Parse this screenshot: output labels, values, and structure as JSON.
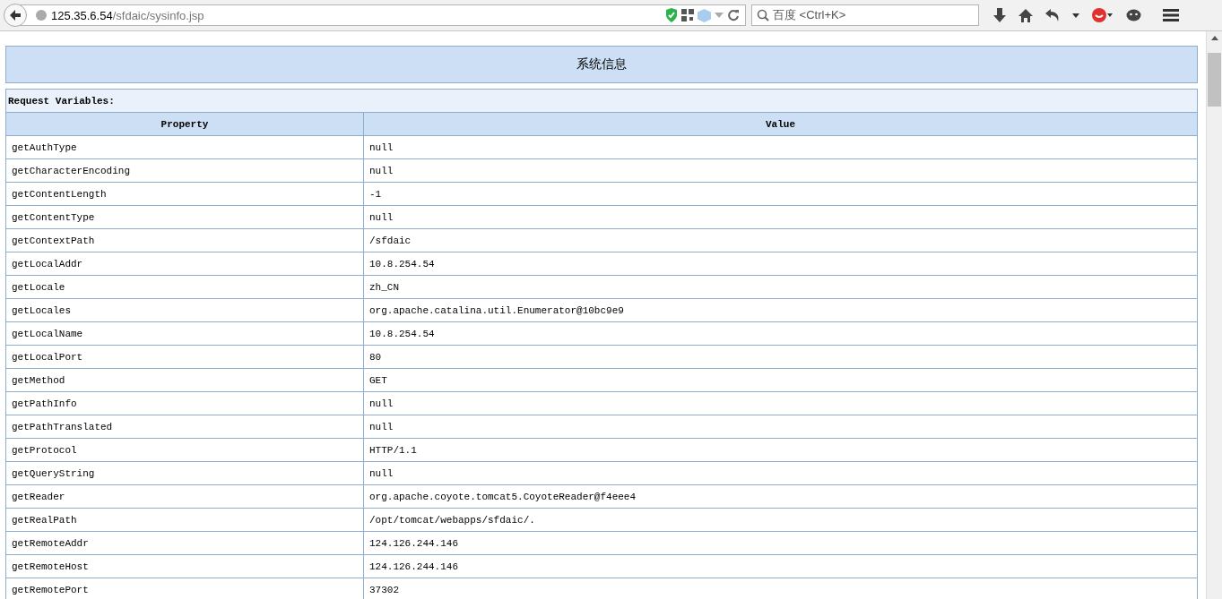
{
  "browser": {
    "url_host": "125.35.6.54",
    "url_path": "/sfdaic/sysinfo.jsp",
    "search_placeholder": "百度 <Ctrl+K>"
  },
  "page": {
    "title": "系统信息",
    "section_title": "Request Variables:",
    "table": {
      "columns": [
        "Property",
        "Value"
      ],
      "rows": [
        [
          "getAuthType",
          "null"
        ],
        [
          "getCharacterEncoding",
          "null"
        ],
        [
          "getContentLength",
          "-1"
        ],
        [
          "getContentType",
          "null"
        ],
        [
          "getContextPath",
          "/sfdaic"
        ],
        [
          "getLocalAddr",
          "10.8.254.54"
        ],
        [
          "getLocale",
          "zh_CN"
        ],
        [
          "getLocales",
          "org.apache.catalina.util.Enumerator@10bc9e9"
        ],
        [
          "getLocalName",
          "10.8.254.54"
        ],
        [
          "getLocalPort",
          "80"
        ],
        [
          "getMethod",
          "GET"
        ],
        [
          "getPathInfo",
          "null"
        ],
        [
          "getPathTranslated",
          "null"
        ],
        [
          "getProtocol",
          "HTTP/1.1"
        ],
        [
          "getQueryString",
          "null"
        ],
        [
          "getReader",
          "org.apache.coyote.tomcat5.CoyoteReader@f4eee4"
        ],
        [
          "getRealPath",
          "/opt/tomcat/webapps/sfdaic/."
        ],
        [
          "getRemoteAddr",
          "124.126.244.146"
        ],
        [
          "getRemoteHost",
          "124.126.244.146"
        ],
        [
          "getRemotePort",
          "37302"
        ]
      ]
    }
  }
}
